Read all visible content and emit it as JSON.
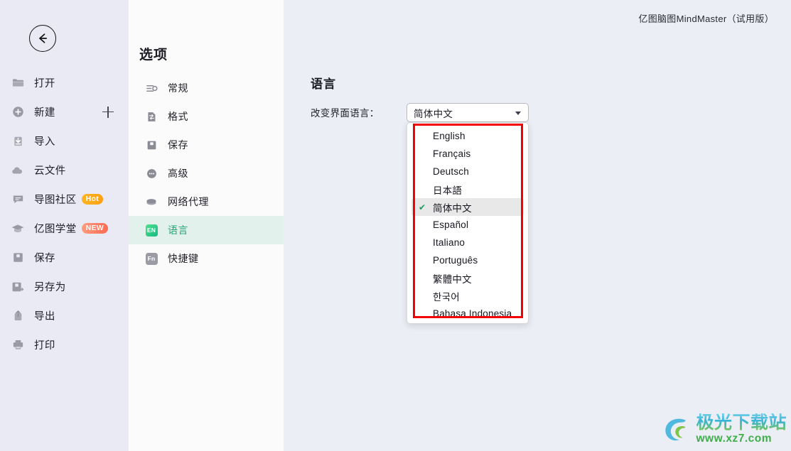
{
  "app": {
    "title": "亿图脑图MindMaster（试用版）"
  },
  "sidebar": {
    "back_icon": "back-arrow-icon",
    "items": [
      {
        "label": "打开",
        "icon": "folder-icon"
      },
      {
        "label": "新建",
        "icon": "plus-circle-icon",
        "trailing": "plus-icon"
      },
      {
        "label": "导入",
        "icon": "import-icon"
      },
      {
        "label": "云文件",
        "icon": "cloud-icon"
      },
      {
        "label": "导图社区",
        "icon": "comment-icon",
        "badge": "Hot"
      },
      {
        "label": "亿图学堂",
        "icon": "graduation-cap-icon",
        "badge": "NEW"
      },
      {
        "label": "保存",
        "icon": "save-icon"
      },
      {
        "label": "另存为",
        "icon": "save-as-icon"
      },
      {
        "label": "导出",
        "icon": "export-icon"
      },
      {
        "label": "打印",
        "icon": "printer-icon"
      }
    ]
  },
  "options": {
    "title": "选项",
    "items": [
      {
        "label": "常规",
        "icon": "sliders-icon",
        "active": false
      },
      {
        "label": "格式",
        "icon": "document-icon",
        "active": false
      },
      {
        "label": "保存",
        "icon": "save-icon",
        "active": false
      },
      {
        "label": "高级",
        "icon": "ellipsis-icon",
        "active": false
      },
      {
        "label": "网络代理",
        "icon": "network-icon",
        "active": false
      },
      {
        "label": "语言",
        "icon": "en-badge-icon",
        "active": true,
        "icon_text": "EN"
      },
      {
        "label": "快捷键",
        "icon": "fn-badge-icon",
        "active": false,
        "icon_text": "Fn"
      }
    ]
  },
  "main": {
    "section_title": "语言",
    "field_label": "改变界面语言：",
    "select": {
      "value": "简体中文",
      "caret_icon": "chevron-down-icon",
      "open": true,
      "options": [
        {
          "label": "English",
          "selected": false
        },
        {
          "label": "Français",
          "selected": false
        },
        {
          "label": "Deutsch",
          "selected": false
        },
        {
          "label": "日本語",
          "selected": false
        },
        {
          "label": "简体中文",
          "selected": true
        },
        {
          "label": "Español",
          "selected": false
        },
        {
          "label": "Italiano",
          "selected": false
        },
        {
          "label": "Português",
          "selected": false
        },
        {
          "label": "繁體中文",
          "selected": false
        },
        {
          "label": "한국어",
          "selected": false
        },
        {
          "label": "Bahasa Indonesia",
          "selected": false
        }
      ],
      "check_glyph": "✔"
    }
  },
  "annotation": {
    "color": "#f40000",
    "shape": "rectangle-highlight"
  },
  "watermark": {
    "name": "极光下载站",
    "url": "www.xz7.com"
  },
  "colors": {
    "sidebar_bg": "#eaeaf4",
    "options_bg": "#fbfbfb",
    "main_bg": "#eceef5",
    "active_item_bg": "#e3f1ec",
    "active_item_text": "#20a573",
    "selected_option_bg": "#e8e8e8",
    "check_green": "#17a05f",
    "badge_hot": "#ffa81a",
    "badge_new": "#fc6a53",
    "annotation_red": "#f40000"
  }
}
